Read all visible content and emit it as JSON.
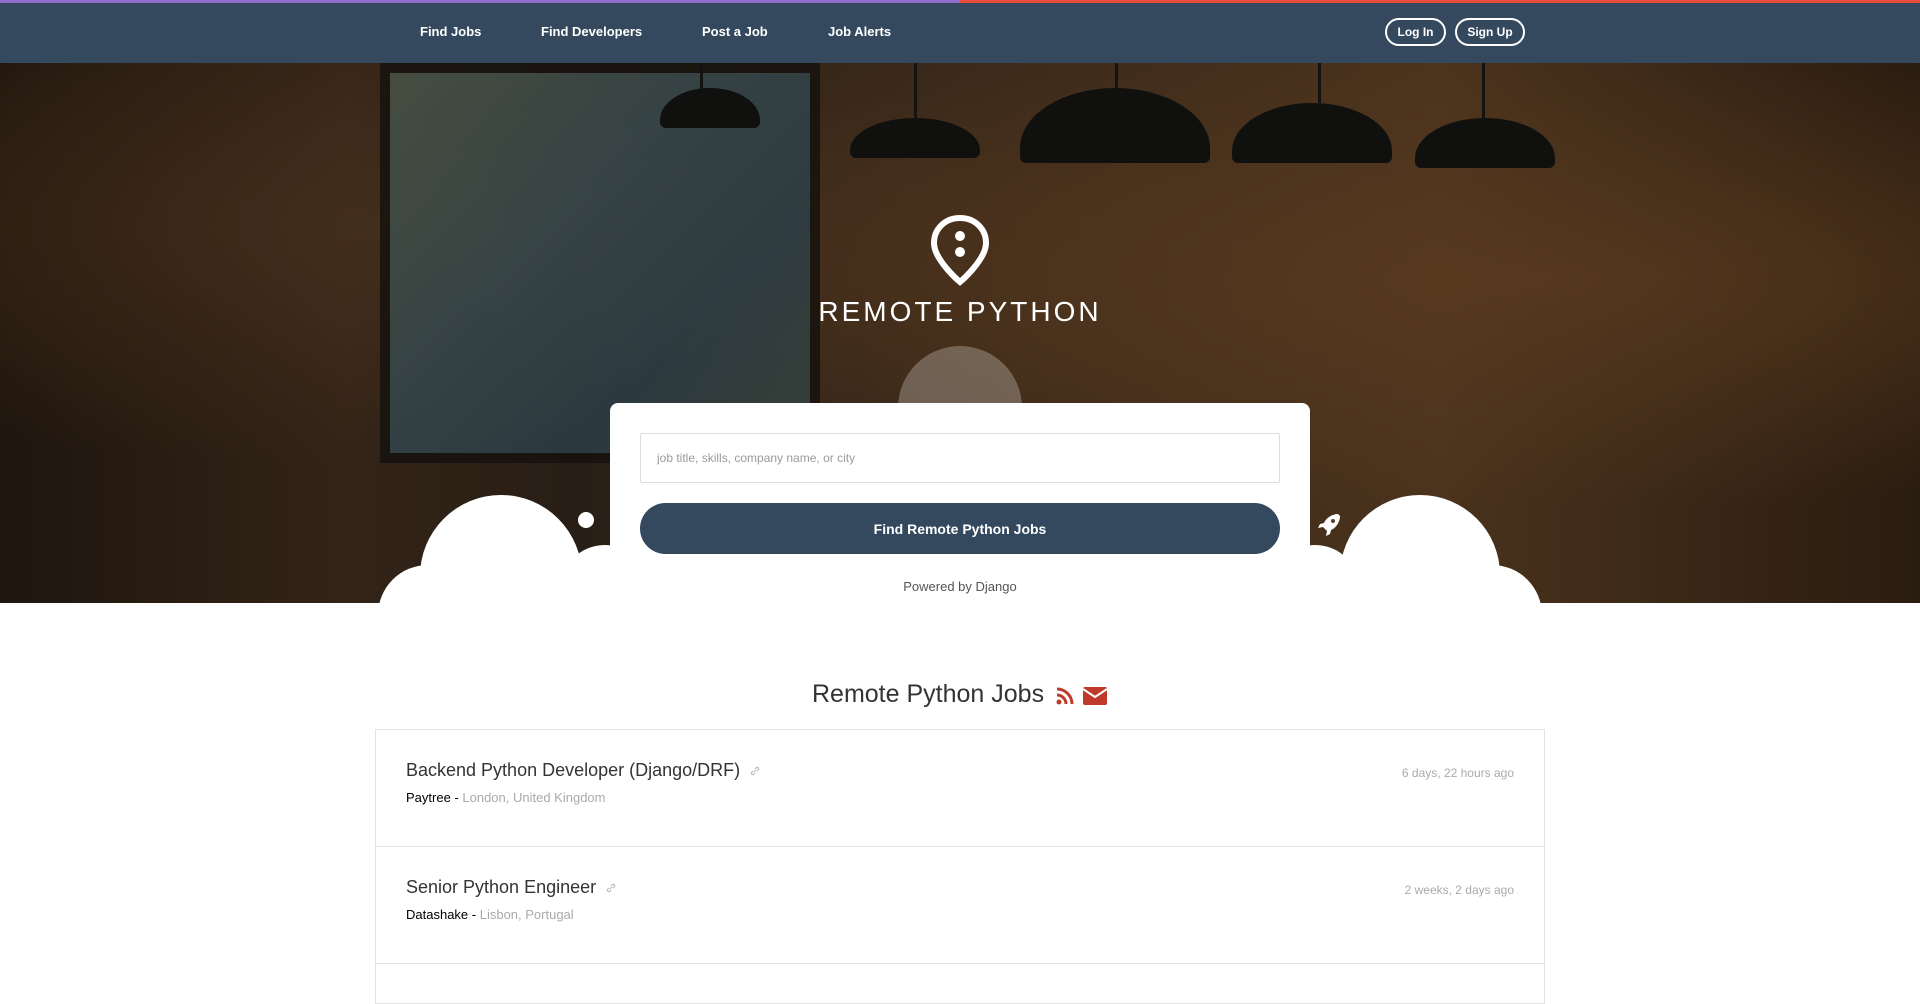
{
  "nav": {
    "links": [
      "Find Jobs",
      "Find Developers",
      "Post a Job",
      "Job Alerts"
    ],
    "login_label": "Log In",
    "signup_label": "Sign Up"
  },
  "hero": {
    "brand": "REMOTE PYTHON",
    "icons": [
      "map-pin-icon",
      "globe-icon",
      "dot-icon",
      "rocket-icon"
    ]
  },
  "search": {
    "placeholder": "job title, skills, company name, or city",
    "value": "",
    "button_label": "Find Remote Python Jobs",
    "powered_by": "Powered by Django"
  },
  "jobs_section": {
    "title": "Remote Python Jobs",
    "icons": [
      "rss-icon",
      "envelope-icon"
    ],
    "accent_color": "#c0392b"
  },
  "jobs": [
    {
      "title": "Backend Python Developer (Django/DRF)",
      "company": "Paytree",
      "separator": " - ",
      "location": "London, United Kingdom",
      "posted": "6 days, 22 hours ago"
    },
    {
      "title": "Senior Python Engineer",
      "company": "Datashake",
      "separator": " - ",
      "location": "Lisbon, Portugal",
      "posted": "2 weeks, 2 days ago"
    }
  ],
  "colors": {
    "navbar": "#34495e",
    "stripe_left": "#8e6cc8",
    "stripe_right": "#e74c3c",
    "button": "#34495e"
  }
}
